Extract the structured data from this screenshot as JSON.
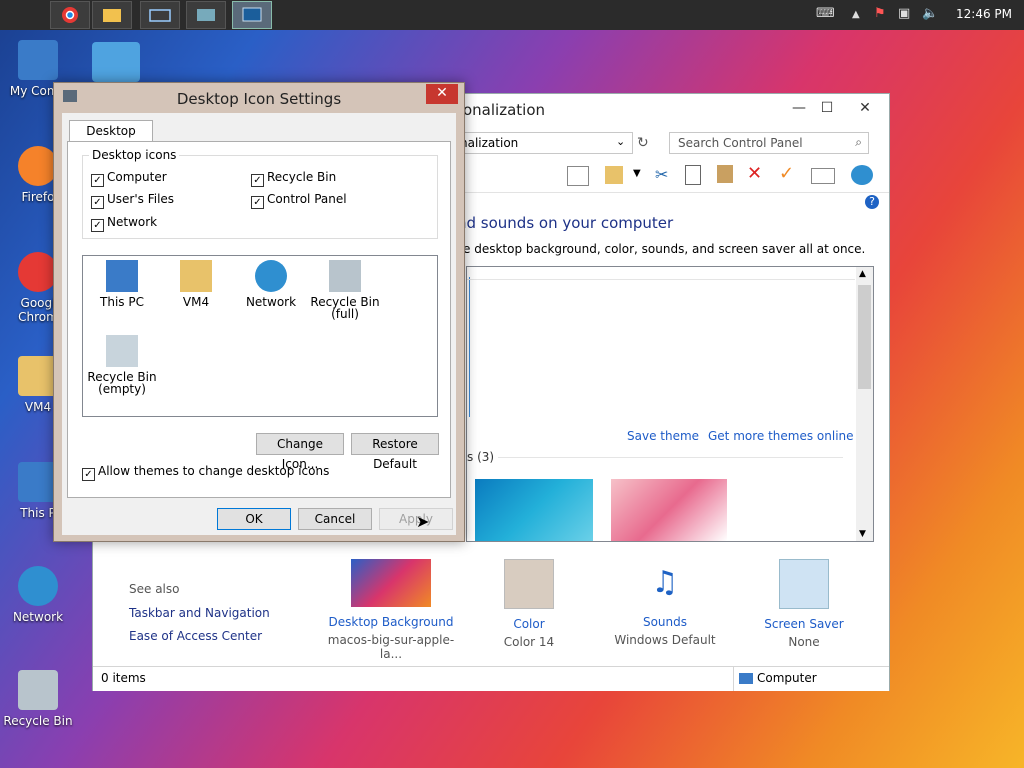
{
  "taskbar": {
    "clock": "12:46 PM",
    "apps": [
      "apple-menu",
      "chrome",
      "file-explorer",
      "keyboard",
      "remote-desktop",
      "personalization-app"
    ]
  },
  "desktop": {
    "icons": [
      {
        "label": "My Comp",
        "icon": "computer-icon"
      },
      {
        "label": "Firefo",
        "icon": "firefox-icon"
      },
      {
        "label": "Googl Chrom",
        "icon": "chrome-icon"
      },
      {
        "label": "VM4",
        "icon": "folder-user-icon"
      },
      {
        "label": "This P",
        "icon": "computer-icon"
      },
      {
        "label": "Network",
        "icon": "network-icon"
      },
      {
        "label": "Recycle Bin",
        "icon": "recycle-bin-icon"
      }
    ]
  },
  "personalization": {
    "title": "onalization",
    "address": "nalization",
    "search_placeholder": "Search Control Panel",
    "heading": "nd sounds on your computer",
    "subheading": "e desktop background, color, sounds, and screen saver all at once.",
    "save_theme": "Save theme",
    "get_more": "Get more themes online",
    "group_label": "s (3)",
    "see_also": "See also",
    "see_also_links": [
      "Taskbar and Navigation",
      "Ease of Access Center"
    ],
    "bottom": [
      {
        "label": "Desktop Background",
        "value": "macos-big-sur-apple-la..."
      },
      {
        "label": "Color",
        "value": "Color 14"
      },
      {
        "label": "Sounds",
        "value": "Windows Default"
      },
      {
        "label": "Screen Saver",
        "value": "None"
      }
    ],
    "status_items": "0 items",
    "status_location": "Computer"
  },
  "dialog": {
    "title": "Desktop Icon Settings",
    "tab": "Desktop Icons",
    "group": "Desktop icons",
    "checkboxes": [
      {
        "label": "Computer",
        "checked": true
      },
      {
        "label": "Recycle Bin",
        "checked": true
      },
      {
        "label": "User's Files",
        "checked": true
      },
      {
        "label": "Control Panel",
        "checked": true
      },
      {
        "label": "Network",
        "checked": true
      }
    ],
    "icons": [
      {
        "label": "This PC"
      },
      {
        "label": "VM4"
      },
      {
        "label": "Network"
      },
      {
        "label": "Recycle Bin (full)"
      },
      {
        "label": "Recycle Bin (empty)"
      }
    ],
    "change_icon": "Change Icon...",
    "restore_default": "Restore Default",
    "allow_themes": "Allow themes to change desktop icons",
    "allow_themes_checked": true,
    "ok": "OK",
    "cancel": "Cancel",
    "apply": "Apply"
  }
}
